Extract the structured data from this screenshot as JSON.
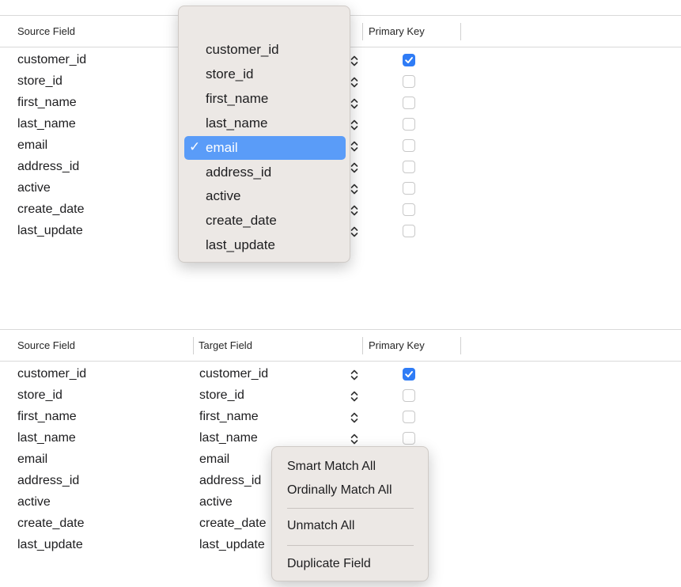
{
  "top_panel": {
    "columns": {
      "source": "Source Field",
      "primary_key": "Primary Key"
    },
    "rows": [
      {
        "source": "customer_id",
        "primary_key": true
      },
      {
        "source": "store_id",
        "primary_key": false
      },
      {
        "source": "first_name",
        "primary_key": false
      },
      {
        "source": "last_name",
        "primary_key": false
      },
      {
        "source": "email",
        "primary_key": false
      },
      {
        "source": "address_id",
        "primary_key": false
      },
      {
        "source": "active",
        "primary_key": false
      },
      {
        "source": "create_date",
        "primary_key": false
      },
      {
        "source": "last_update",
        "primary_key": false
      }
    ],
    "dropdown": {
      "options": [
        "customer_id",
        "store_id",
        "first_name",
        "last_name",
        "email",
        "address_id",
        "active",
        "create_date",
        "last_update"
      ],
      "selected": "email",
      "check_glyph": "✓"
    }
  },
  "bottom_panel": {
    "columns": {
      "source": "Source Field",
      "target": "Target Field",
      "primary_key": "Primary Key"
    },
    "rows": [
      {
        "source": "customer_id",
        "target": "customer_id",
        "primary_key": true
      },
      {
        "source": "store_id",
        "target": "store_id",
        "primary_key": false
      },
      {
        "source": "first_name",
        "target": "first_name",
        "primary_key": false
      },
      {
        "source": "last_name",
        "target": "last_name",
        "primary_key": false
      },
      {
        "source": "email",
        "target": "email",
        "primary_key": false
      },
      {
        "source": "address_id",
        "target": "address_id",
        "primary_key": false
      },
      {
        "source": "active",
        "target": "active",
        "primary_key": false
      },
      {
        "source": "create_date",
        "target": "create_date",
        "primary_key": false
      },
      {
        "source": "last_update",
        "target": "last_update",
        "primary_key": false
      }
    ],
    "context_menu": {
      "items": [
        "Smart Match All",
        "Ordinally Match All",
        "Unmatch All",
        "Duplicate Field"
      ]
    }
  },
  "colors": {
    "accent": "#2f7cf6",
    "selection": "#5a9cf8",
    "menu_background": "#ece8e5"
  }
}
